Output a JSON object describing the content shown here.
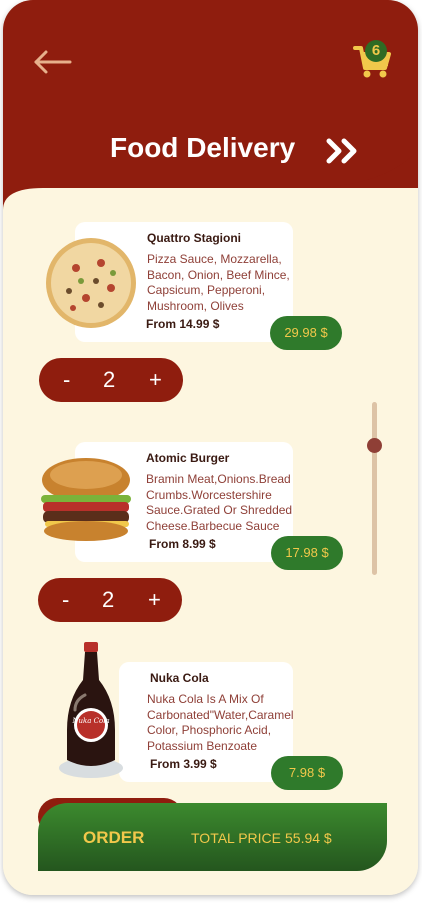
{
  "header": {
    "title": "Food Delivery",
    "cart_count": "6"
  },
  "items": [
    {
      "name": "Quattro Stagioni",
      "description_lines": [
        "Pizza Sauce, Mozzarella,",
        "Bacon, Onion, Beef Mince,",
        "Capsicum, Pepperoni,",
        "Mushroom, Olives"
      ],
      "from_price": "From 14.99 $",
      "total": "29.98 $",
      "quantity": "2"
    },
    {
      "name": "Atomic Burger",
      "description_lines": [
        "Bramin Meat,Onions.Bread",
        "Crumbs.Worcestershire",
        "Sauce.Grated Or Shredded",
        "Cheese.Barbecue Sauce"
      ],
      "from_price": "From 8.99 $",
      "total": "17.98 $",
      "quantity": "2"
    },
    {
      "name": "Nuka Cola",
      "description_lines": [
        "Nuka Cola Is A Mix Of",
        "Carbonated\"Water,Caramel",
        "Color, Phosphoric Acid,",
        "Potassium Benzoate"
      ],
      "from_price": "From 3.99 $",
      "total": "7.98 $"
    }
  ],
  "quantity_controls": {
    "minus": "-",
    "plus": "+"
  },
  "nuka_label": "Nuka Cola",
  "order_bar": {
    "order_label": "ORDER",
    "total_label": "TOTAL PRICE",
    "total_value": "55.94 $"
  },
  "colors": {
    "primary_red": "#8f1d0e",
    "accent_green": "#2f7a2b",
    "accent_yellow": "#f1c84b",
    "background_cream": "#fdf6e0"
  },
  "icons": [
    "back-arrow-icon",
    "cart-icon",
    "double-chevron-icon"
  ]
}
